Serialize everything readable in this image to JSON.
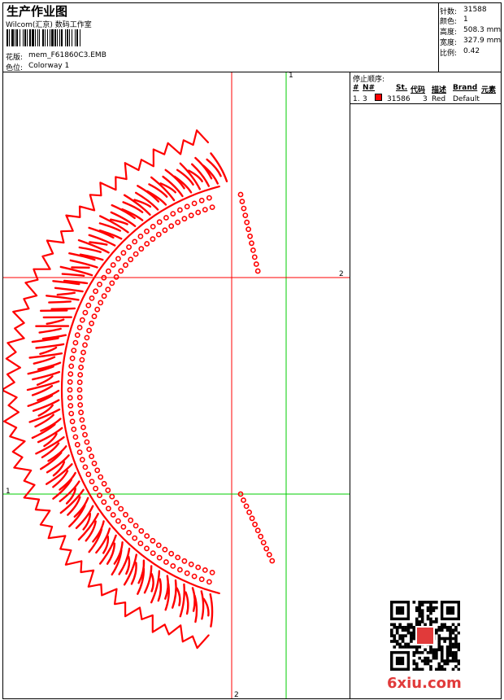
{
  "header": {
    "title": "生产作业图",
    "company": "Wilcom(汇京) 数码工作室",
    "design_label": "花版:",
    "design_value": "mem_F61860C3.EMB",
    "colorway_label": "色位:",
    "colorway_value": "Colorway 1"
  },
  "info": {
    "stitches_label": "针数:",
    "stitches_value": "31588",
    "colors_label": "颜色:",
    "colors_value": "1",
    "height_label": "高度:",
    "height_value": "508.3 mm",
    "width_label": "宽度:",
    "width_value": "327.9 mm",
    "scale_label": "比例:",
    "scale_value": "0.42"
  },
  "stop_sequence": {
    "title": "停止顺序:",
    "headers": [
      "#",
      "N#",
      "St.",
      "代码",
      "描述",
      "Brand",
      "元素"
    ],
    "rows": [
      {
        "index": "1.",
        "needle": "3",
        "stitches": "31586",
        "code": "3",
        "description": "Red",
        "brand": "Default",
        "color": "#ff0000"
      }
    ]
  },
  "guides": {
    "v1_label": "1",
    "h2_label": "2",
    "h1_label": "1",
    "v2_label": "2",
    "guide_green": "#00cc00",
    "guide_red": "#ff0000"
  },
  "embroidery_color": "#ff0000",
  "watermark": {
    "text": "6xiu.com"
  }
}
